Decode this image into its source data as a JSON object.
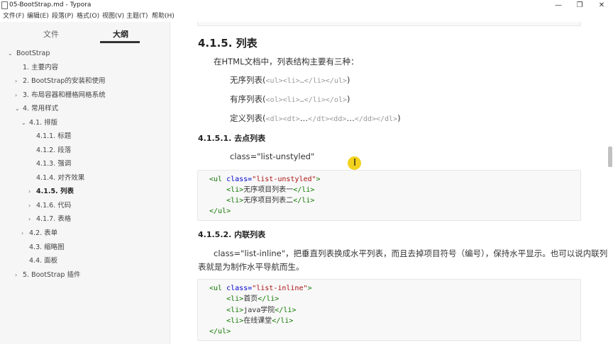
{
  "window": {
    "title": "05-BootStrap.md - Typora",
    "minimize_glyph": "—",
    "maximize_glyph": "❐",
    "close_glyph": "✕"
  },
  "menu": [
    "文件(F)",
    "编辑(E)",
    "段落(P)",
    "格式(O)",
    "视图(V)",
    "主题(T)",
    "帮助(H)"
  ],
  "sidebar": {
    "tab_files": "文件",
    "tab_outline": "大纲",
    "outline": [
      {
        "label": "BootStrap",
        "caret": "⌄"
      },
      {
        "label": "1. 主要内容",
        "caret": ""
      },
      {
        "label": "2. BootStrap的安装和使用",
        "caret": "›"
      },
      {
        "label": "3. 布局容器和栅格网格系统",
        "caret": "›"
      },
      {
        "label": "4. 常用样式",
        "caret": "⌄"
      },
      {
        "label": "4.1. 排版",
        "caret": "⌄"
      },
      {
        "label": "4.1.1. 标题",
        "caret": ""
      },
      {
        "label": "4.1.2. 段落",
        "caret": ""
      },
      {
        "label": "4.1.3. 强调",
        "caret": ""
      },
      {
        "label": "4.1.4. 对齐效果",
        "caret": ""
      },
      {
        "label": "4.1.5. 列表",
        "caret": "›"
      },
      {
        "label": "4.1.6. 代码",
        "caret": "›"
      },
      {
        "label": "4.1.7. 表格",
        "caret": "›"
      },
      {
        "label": "4.2. 表单",
        "caret": "›"
      },
      {
        "label": "4.3. 缩略图",
        "caret": ""
      },
      {
        "label": "4.4. 面板",
        "caret": ""
      },
      {
        "label": "5. BootStrap 插件",
        "caret": "›"
      }
    ]
  },
  "doc": {
    "h_lists": "4.1.5. 列表",
    "intro": "在HTML文档中，列表结构主要有三种：",
    "ul_label": "无序列表(",
    "ul_code": "<ul><li>…</li></ul>",
    "ol_label": "有序列表(",
    "ol_code": "<ol><li>…</li></ol>",
    "dl_label": "定义列表(",
    "dl_code_a": "<dl><dt>",
    "dl_code_b": "…",
    "dl_code_c": "</dt><dd>",
    "dl_code_d": "…",
    "dl_code_e": "</dd></dl>",
    "close_paren": ")",
    "h_unstyled": "4.1.5.1. 去点列表",
    "unstyled_text": "class=\"list-unstyled\"",
    "code1": {
      "l1_tag": "<ul",
      "l1_attr": " class=",
      "l1_str": "\"list-unstyled\"",
      "l1_end": ">",
      "l2_open": "<li>",
      "l2_text": "无序项目列表一",
      "l2_close": "</li>",
      "l3_open": "<li>",
      "l3_text": "无序项目列表二",
      "l3_close": "</li>",
      "l4": "</ul>"
    },
    "h_inline": "4.1.5.2. 内联列表",
    "inline_text_1": "class=\"list-inline\"，把垂直列表换成水平列表，而且去掉项目符号（编号），保持水平显示。也可以说内联列",
    "inline_text_2": "表就是为制作水平导航而生。",
    "code2": {
      "l1_tag": "<ul",
      "l1_attr": " class=",
      "l1_str": "\"list-inline\"",
      "l1_end": ">",
      "l2_open": "<li>",
      "l2_text": "首页",
      "l2_close": "</li>",
      "l3_open": "<li>",
      "l3_text": "java学院",
      "l3_close": "</li>",
      "l4_open": "<li>",
      "l4_text": "在线课堂",
      "l4_close": "</li>",
      "l5": "</ul>"
    }
  },
  "cursor_glyph": "I"
}
